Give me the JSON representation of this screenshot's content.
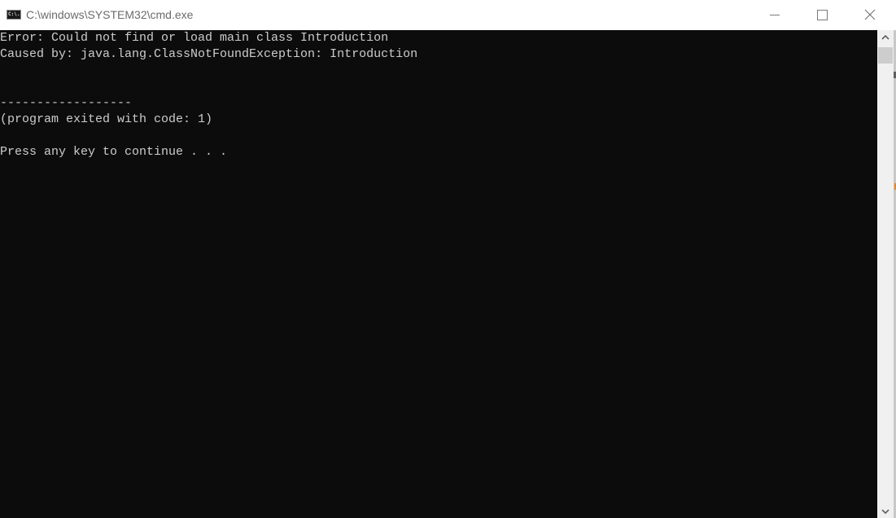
{
  "window": {
    "title": "C:\\windows\\SYSTEM32\\cmd.exe",
    "icon": "cmd-icon",
    "icon_text": "C:\\.",
    "controls": {
      "minimize": "minimize-icon",
      "maximize": "maximize-icon",
      "close": "close-icon",
      "close_glyph": "✕"
    }
  },
  "console": {
    "lines": [
      "Error: Could not find or load main class Introduction",
      "Caused by: java.lang.ClassNotFoundException: Introduction",
      "",
      "",
      "------------------",
      "(program exited with code: 1)",
      "",
      "Press any key to continue . . ."
    ],
    "background": "#0c0c0c",
    "foreground": "#cccccc"
  },
  "scrollbar": {
    "up_glyph": "⌃",
    "down_glyph": "⌄"
  }
}
